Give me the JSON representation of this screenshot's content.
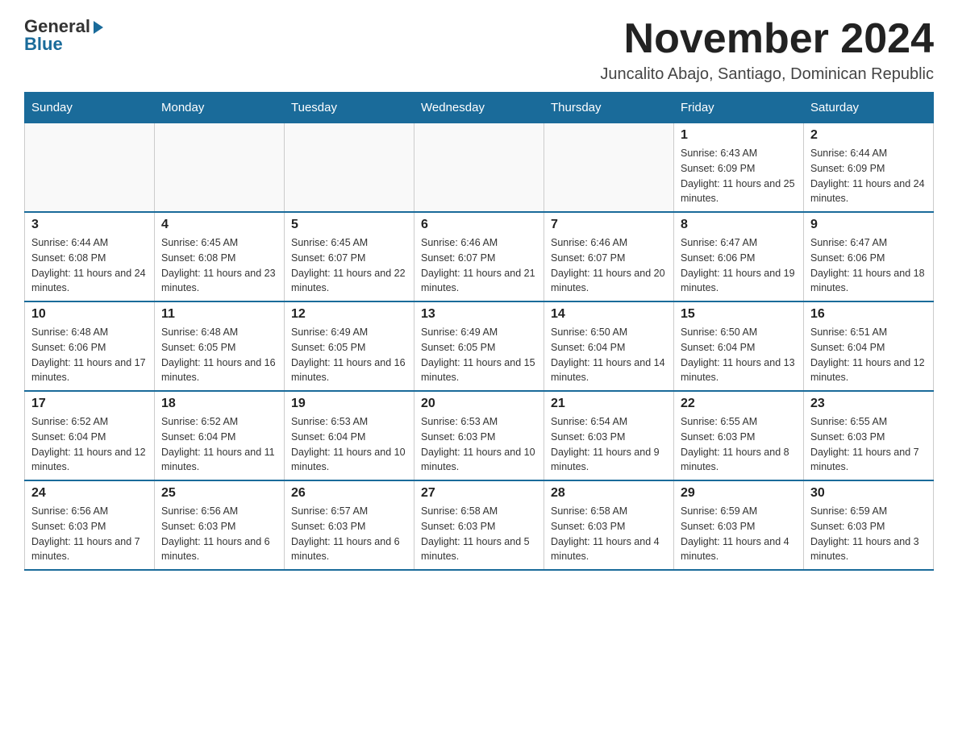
{
  "logo": {
    "general": "General",
    "blue": "Blue"
  },
  "title": "November 2024",
  "subtitle": "Juncalito Abajo, Santiago, Dominican Republic",
  "days_of_week": [
    "Sunday",
    "Monday",
    "Tuesday",
    "Wednesday",
    "Thursday",
    "Friday",
    "Saturday"
  ],
  "weeks": [
    [
      {
        "day": "",
        "sunrise": "",
        "sunset": "",
        "daylight": ""
      },
      {
        "day": "",
        "sunrise": "",
        "sunset": "",
        "daylight": ""
      },
      {
        "day": "",
        "sunrise": "",
        "sunset": "",
        "daylight": ""
      },
      {
        "day": "",
        "sunrise": "",
        "sunset": "",
        "daylight": ""
      },
      {
        "day": "",
        "sunrise": "",
        "sunset": "",
        "daylight": ""
      },
      {
        "day": "1",
        "sunrise": "Sunrise: 6:43 AM",
        "sunset": "Sunset: 6:09 PM",
        "daylight": "Daylight: 11 hours and 25 minutes."
      },
      {
        "day": "2",
        "sunrise": "Sunrise: 6:44 AM",
        "sunset": "Sunset: 6:09 PM",
        "daylight": "Daylight: 11 hours and 24 minutes."
      }
    ],
    [
      {
        "day": "3",
        "sunrise": "Sunrise: 6:44 AM",
        "sunset": "Sunset: 6:08 PM",
        "daylight": "Daylight: 11 hours and 24 minutes."
      },
      {
        "day": "4",
        "sunrise": "Sunrise: 6:45 AM",
        "sunset": "Sunset: 6:08 PM",
        "daylight": "Daylight: 11 hours and 23 minutes."
      },
      {
        "day": "5",
        "sunrise": "Sunrise: 6:45 AM",
        "sunset": "Sunset: 6:07 PM",
        "daylight": "Daylight: 11 hours and 22 minutes."
      },
      {
        "day": "6",
        "sunrise": "Sunrise: 6:46 AM",
        "sunset": "Sunset: 6:07 PM",
        "daylight": "Daylight: 11 hours and 21 minutes."
      },
      {
        "day": "7",
        "sunrise": "Sunrise: 6:46 AM",
        "sunset": "Sunset: 6:07 PM",
        "daylight": "Daylight: 11 hours and 20 minutes."
      },
      {
        "day": "8",
        "sunrise": "Sunrise: 6:47 AM",
        "sunset": "Sunset: 6:06 PM",
        "daylight": "Daylight: 11 hours and 19 minutes."
      },
      {
        "day": "9",
        "sunrise": "Sunrise: 6:47 AM",
        "sunset": "Sunset: 6:06 PM",
        "daylight": "Daylight: 11 hours and 18 minutes."
      }
    ],
    [
      {
        "day": "10",
        "sunrise": "Sunrise: 6:48 AM",
        "sunset": "Sunset: 6:06 PM",
        "daylight": "Daylight: 11 hours and 17 minutes."
      },
      {
        "day": "11",
        "sunrise": "Sunrise: 6:48 AM",
        "sunset": "Sunset: 6:05 PM",
        "daylight": "Daylight: 11 hours and 16 minutes."
      },
      {
        "day": "12",
        "sunrise": "Sunrise: 6:49 AM",
        "sunset": "Sunset: 6:05 PM",
        "daylight": "Daylight: 11 hours and 16 minutes."
      },
      {
        "day": "13",
        "sunrise": "Sunrise: 6:49 AM",
        "sunset": "Sunset: 6:05 PM",
        "daylight": "Daylight: 11 hours and 15 minutes."
      },
      {
        "day": "14",
        "sunrise": "Sunrise: 6:50 AM",
        "sunset": "Sunset: 6:04 PM",
        "daylight": "Daylight: 11 hours and 14 minutes."
      },
      {
        "day": "15",
        "sunrise": "Sunrise: 6:50 AM",
        "sunset": "Sunset: 6:04 PM",
        "daylight": "Daylight: 11 hours and 13 minutes."
      },
      {
        "day": "16",
        "sunrise": "Sunrise: 6:51 AM",
        "sunset": "Sunset: 6:04 PM",
        "daylight": "Daylight: 11 hours and 12 minutes."
      }
    ],
    [
      {
        "day": "17",
        "sunrise": "Sunrise: 6:52 AM",
        "sunset": "Sunset: 6:04 PM",
        "daylight": "Daylight: 11 hours and 12 minutes."
      },
      {
        "day": "18",
        "sunrise": "Sunrise: 6:52 AM",
        "sunset": "Sunset: 6:04 PM",
        "daylight": "Daylight: 11 hours and 11 minutes."
      },
      {
        "day": "19",
        "sunrise": "Sunrise: 6:53 AM",
        "sunset": "Sunset: 6:04 PM",
        "daylight": "Daylight: 11 hours and 10 minutes."
      },
      {
        "day": "20",
        "sunrise": "Sunrise: 6:53 AM",
        "sunset": "Sunset: 6:03 PM",
        "daylight": "Daylight: 11 hours and 10 minutes."
      },
      {
        "day": "21",
        "sunrise": "Sunrise: 6:54 AM",
        "sunset": "Sunset: 6:03 PM",
        "daylight": "Daylight: 11 hours and 9 minutes."
      },
      {
        "day": "22",
        "sunrise": "Sunrise: 6:55 AM",
        "sunset": "Sunset: 6:03 PM",
        "daylight": "Daylight: 11 hours and 8 minutes."
      },
      {
        "day": "23",
        "sunrise": "Sunrise: 6:55 AM",
        "sunset": "Sunset: 6:03 PM",
        "daylight": "Daylight: 11 hours and 7 minutes."
      }
    ],
    [
      {
        "day": "24",
        "sunrise": "Sunrise: 6:56 AM",
        "sunset": "Sunset: 6:03 PM",
        "daylight": "Daylight: 11 hours and 7 minutes."
      },
      {
        "day": "25",
        "sunrise": "Sunrise: 6:56 AM",
        "sunset": "Sunset: 6:03 PM",
        "daylight": "Daylight: 11 hours and 6 minutes."
      },
      {
        "day": "26",
        "sunrise": "Sunrise: 6:57 AM",
        "sunset": "Sunset: 6:03 PM",
        "daylight": "Daylight: 11 hours and 6 minutes."
      },
      {
        "day": "27",
        "sunrise": "Sunrise: 6:58 AM",
        "sunset": "Sunset: 6:03 PM",
        "daylight": "Daylight: 11 hours and 5 minutes."
      },
      {
        "day": "28",
        "sunrise": "Sunrise: 6:58 AM",
        "sunset": "Sunset: 6:03 PM",
        "daylight": "Daylight: 11 hours and 4 minutes."
      },
      {
        "day": "29",
        "sunrise": "Sunrise: 6:59 AM",
        "sunset": "Sunset: 6:03 PM",
        "daylight": "Daylight: 11 hours and 4 minutes."
      },
      {
        "day": "30",
        "sunrise": "Sunrise: 6:59 AM",
        "sunset": "Sunset: 6:03 PM",
        "daylight": "Daylight: 11 hours and 3 minutes."
      }
    ]
  ]
}
